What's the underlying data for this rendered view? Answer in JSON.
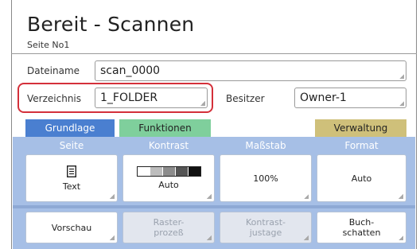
{
  "header": {
    "title": "Bereit - Scannen",
    "subtitle": "Seite No1"
  },
  "fields": {
    "filename": {
      "label": "Dateiname",
      "value": "scan_0000"
    },
    "directory": {
      "label": "Verzeichnis",
      "value": "1_FOLDER"
    },
    "owner": {
      "label": "Besitzer",
      "value": "Owner-1"
    }
  },
  "tabs": {
    "basic": {
      "label": "Grundlage",
      "color": "#4a7fd0"
    },
    "functions": {
      "label": "Funktionen",
      "color": "#7fcf9c"
    },
    "admin": {
      "label": "Verwaltung",
      "color": "#cfc07a"
    }
  },
  "columns": {
    "page": "Seite",
    "contrast": "Kontrast",
    "scale": "Maßstab",
    "format": "Format"
  },
  "buttons": {
    "page": {
      "icon": "document-icon",
      "label": "Text"
    },
    "contrast": {
      "label": "Auto"
    },
    "scale": {
      "label": "100%"
    },
    "format": {
      "label": "Auto"
    },
    "preview": {
      "label": "Vorschau"
    },
    "raster": {
      "label": "Raster-\nprozeß",
      "enabled": false
    },
    "contrast_adjust": {
      "label": "Kontrast-\njustage",
      "enabled": false
    },
    "book_shadow": {
      "label": "Buch-\nschatten"
    }
  },
  "colors": {
    "highlight": "#d4303a",
    "panel": "#a6bfe6"
  }
}
